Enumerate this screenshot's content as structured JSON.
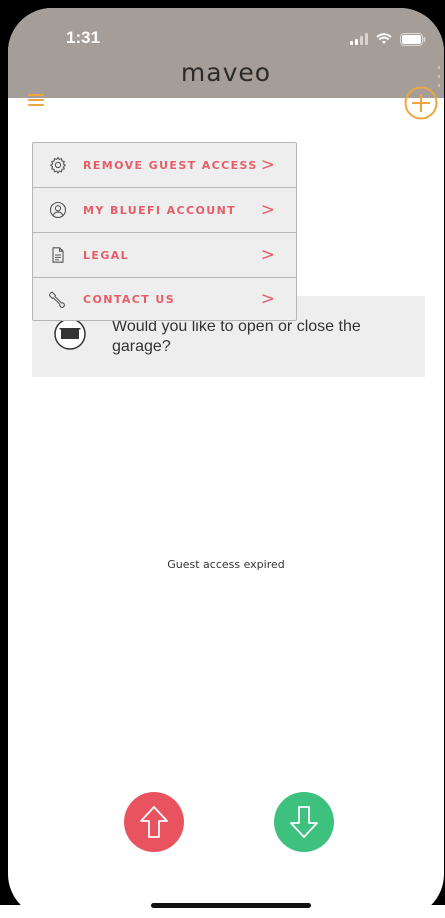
{
  "status_bar": {
    "time": "1:31",
    "icons": [
      "signal-icon",
      "wifi-icon",
      "battery-icon"
    ]
  },
  "header": {
    "logo_text": "maveo",
    "icons": [
      "menu-icon",
      "add-icon"
    ]
  },
  "menu": {
    "items": [
      {
        "label": "REMOVE GUEST ACCESS",
        "icon": "gear-icon",
        "chevron": ">"
      },
      {
        "label": "MY BLUEFI ACCOUNT",
        "icon": "account-icon",
        "chevron": ">"
      },
      {
        "label": "LEGAL",
        "icon": "document-icon",
        "chevron": ">"
      },
      {
        "label": "CONTACT US",
        "icon": "wrench-icon",
        "chevron": ">"
      }
    ]
  },
  "card": {
    "icon": "garage-door-icon",
    "text": "Would you like to open or close the garage?"
  },
  "main": {
    "status_text": "Guest access expired"
  },
  "controls": {
    "open_icon": "arrow-up-icon",
    "close_icon": "arrow-down-icon"
  },
  "colors": {
    "header_bg": "#a59d97",
    "accent_orange": "#f0a640",
    "menu_text": "#e65d68",
    "open_button": "#e8535f",
    "close_button": "#3ec07f"
  }
}
